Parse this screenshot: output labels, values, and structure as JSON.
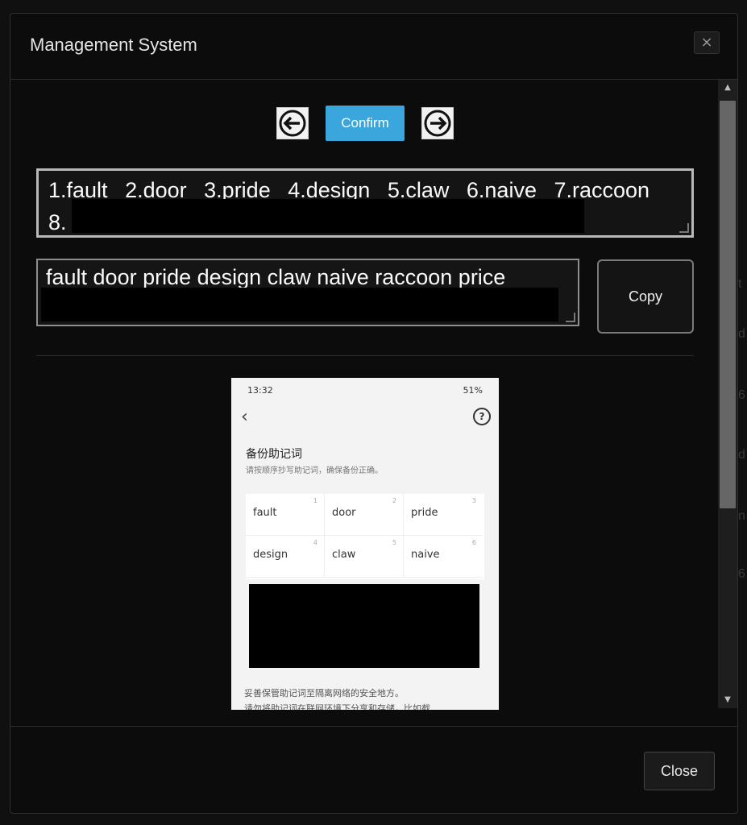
{
  "modal": {
    "title": "Management System",
    "close_icon": "×"
  },
  "nav": {
    "prev_icon": "arrow-left-icon",
    "next_icon": "arrow-right-icon",
    "confirm_label": "Confirm"
  },
  "words": {
    "items": [
      "1.fault",
      "2.door",
      "3.pride",
      "4.design",
      "5.claw",
      "6.naive",
      "7.raccoon"
    ],
    "item_8": "8."
  },
  "phrase": {
    "text": "fault door pride design claw naive raccoon price"
  },
  "copy_label": "Copy",
  "phone": {
    "status_time": "13:32",
    "status_right": "51%",
    "title": "备份助记词",
    "subtitle": "请按顺序抄写助记词，确保备份正确。",
    "cells": [
      {
        "num": "1",
        "word": "fault"
      },
      {
        "num": "2",
        "word": "door"
      },
      {
        "num": "3",
        "word": "pride"
      },
      {
        "num": "4",
        "word": "design"
      },
      {
        "num": "5",
        "word": "claw"
      },
      {
        "num": "6",
        "word": "naive"
      }
    ],
    "note_1": "妥善保管助记词至隔离网络的安全地方。",
    "note_2": "请勿将助记词在联网环境下分享和存储，比如截"
  },
  "footer": {
    "close_label": "Close"
  },
  "background_letters": [
    "t",
    "d",
    "6",
    "d",
    "n",
    "6"
  ]
}
